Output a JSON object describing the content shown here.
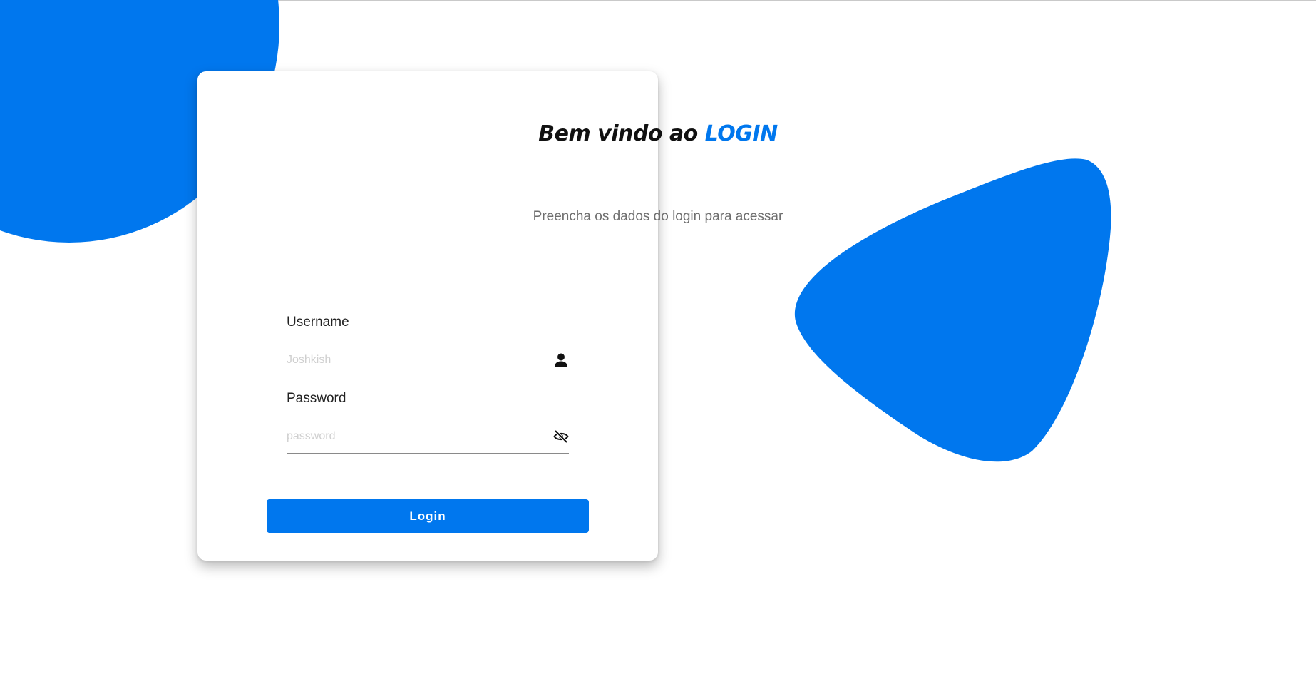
{
  "colors": {
    "accent": "#0077ee",
    "background": "#ffffff",
    "text": "#111111",
    "muted": "#6e6e6e"
  },
  "login": {
    "title_prefix": "Bem vindo ao",
    "title_highlight": "LOGIN",
    "subtitle": "Preencha os dados do login para acessar",
    "username": {
      "label": "Username",
      "placeholder": "Joshkish",
      "value": "",
      "icon": "user-icon"
    },
    "password": {
      "label": "Password",
      "placeholder": "password",
      "value": "",
      "icon": "eye-slash-icon"
    },
    "submit_label": "Login"
  }
}
